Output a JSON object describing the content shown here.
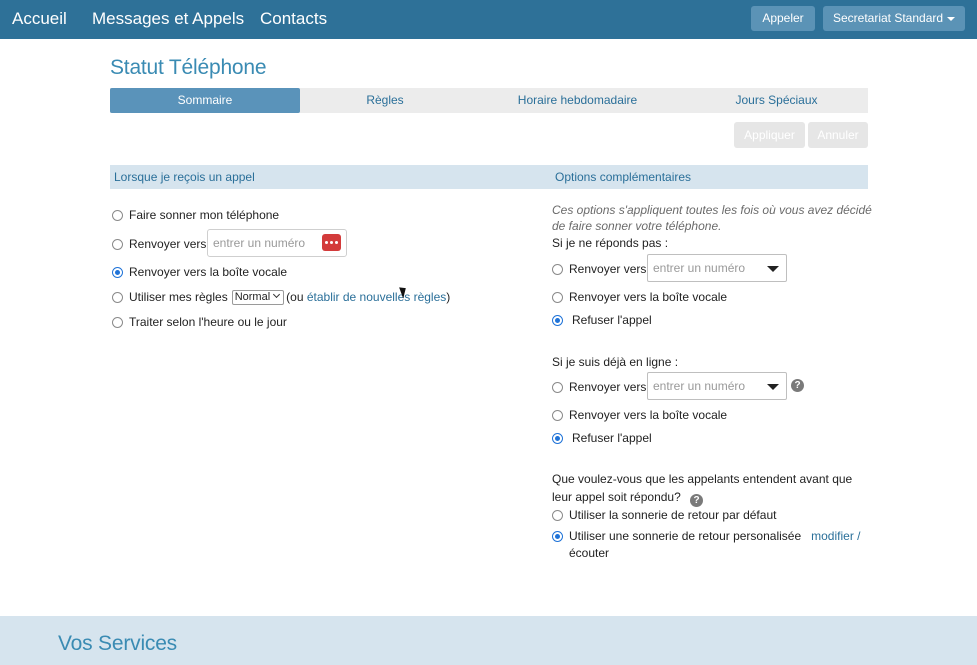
{
  "navbar": {
    "brand": "Accueil",
    "messages": "Messages et Appels",
    "contacts": "Contacts",
    "call_button": "Appeler",
    "account_button": "Secretariat Standard"
  },
  "page": {
    "title": "Statut Téléphone"
  },
  "tabs": [
    {
      "label": "Sommaire",
      "active": true
    },
    {
      "label": "Règles",
      "active": false
    },
    {
      "label": "Horaire hebdomadaire",
      "active": false
    },
    {
      "label": "Jours Spéciaux",
      "active": false
    }
  ],
  "actions": {
    "apply": "Appliquer",
    "cancel": "Annuler"
  },
  "left": {
    "header": "Lorsque je reçois un appel",
    "option_ring": "Faire sonner mon téléphone",
    "option_forward": "Renvoyer vers",
    "forward_placeholder": "entrer un numéro",
    "option_voicemail": "Renvoyer vers la boîte vocale",
    "option_rules": "Utiliser mes règles",
    "rules_select": "Normal",
    "rules_open": "(ou",
    "rules_link": "établir de nouvelles règles",
    "rules_close": ")",
    "option_schedule": "Traiter selon l'heure ou le jour",
    "selected": "voicemail"
  },
  "right": {
    "header": "Options complémentaires",
    "note": "Ces options s'appliquent toutes les fois où vous avez décidé de faire sonner votre téléphone.",
    "noanswer": {
      "label": "Si je ne réponds pas :",
      "option_forward": "Renvoyer vers",
      "forward_placeholder": "entrer un numéro",
      "option_voicemail": "Renvoyer vers la boîte vocale",
      "option_refuse": "Refuser l'appel",
      "selected": "refuse"
    },
    "busy": {
      "label": "Si je suis déjà en ligne :",
      "option_forward": "Renvoyer vers",
      "forward_placeholder": "entrer un numéro",
      "option_voicemail": "Renvoyer vers la boîte vocale",
      "option_refuse": "Refuser l'appel",
      "selected": "refuse"
    },
    "ringback": {
      "question_line1": "Que voulez-vous que les appelants entendent avant que",
      "question_line2": "leur appel soit répondu?",
      "option_default": "Utiliser la sonnerie de retour par défaut",
      "option_custom": "Utiliser une sonnerie de retour personalisée",
      "link_modify": "modifier /",
      "link_listen": "écouter",
      "selected": "custom"
    }
  },
  "footer": {
    "title": "Vos Services"
  },
  "icons": {
    "help": "?",
    "help_color": "#7a7a7a",
    "dots_color": "#d33b3b"
  },
  "colors": {
    "navbar": "#2e7198",
    "accent": "#3a8bb3",
    "active_tab": "#5a93ba",
    "section_bg": "#d6e4ee",
    "radio_selected": "#1f73d8"
  }
}
